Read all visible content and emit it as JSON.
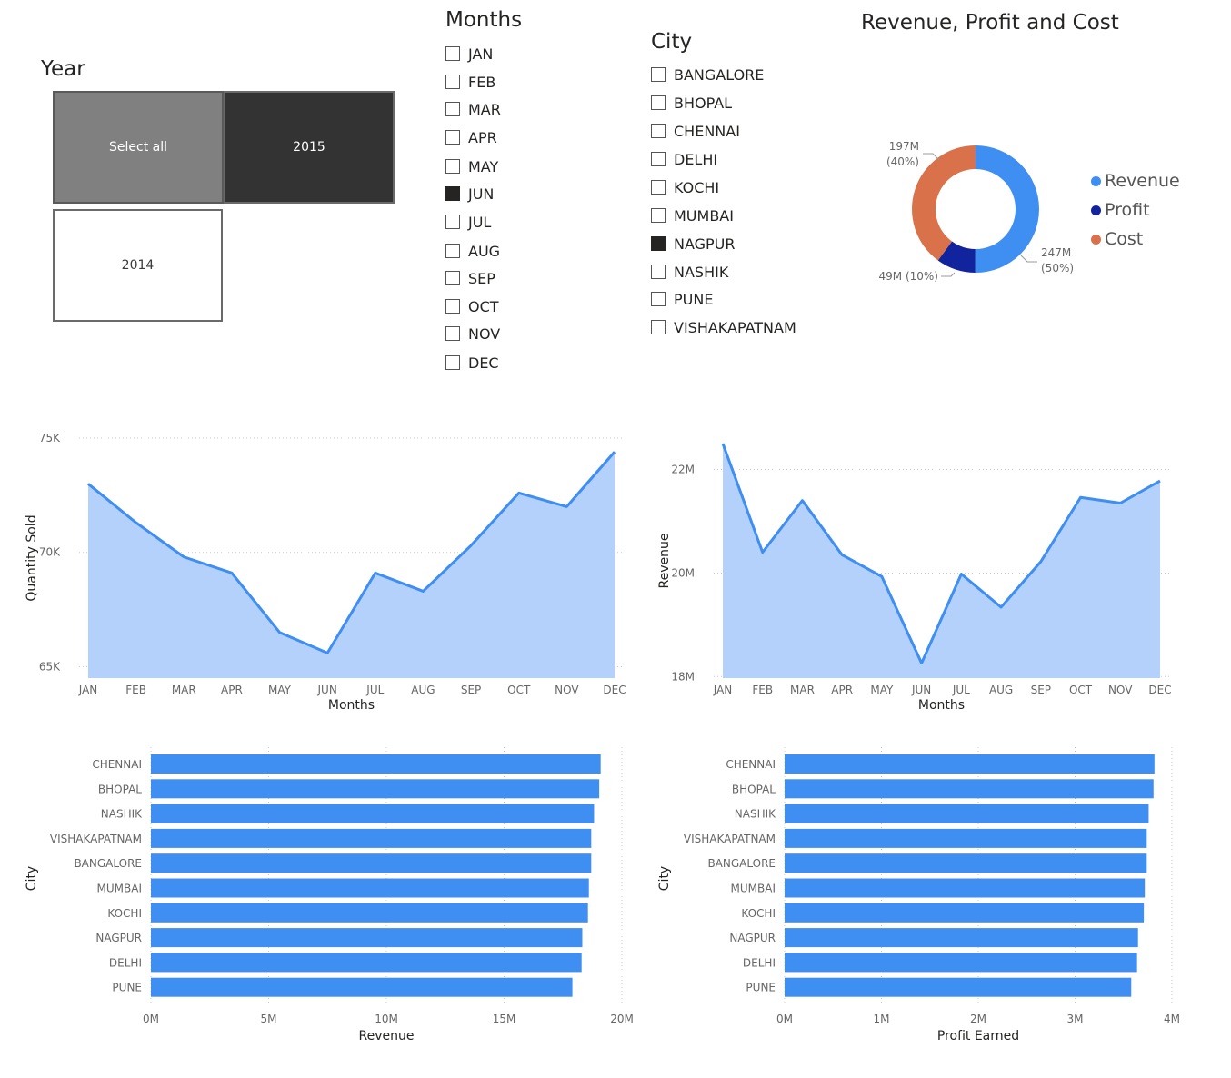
{
  "year_slicer": {
    "title": "Year",
    "tiles": [
      {
        "label": "Select all",
        "state": "partial"
      },
      {
        "label": "2015",
        "state": "selected"
      },
      {
        "label": "2014",
        "state": "unselected"
      }
    ]
  },
  "months_slicer": {
    "title": "Months",
    "items": [
      {
        "label": "JAN",
        "checked": false
      },
      {
        "label": "FEB",
        "checked": false
      },
      {
        "label": "MAR",
        "checked": false
      },
      {
        "label": "APR",
        "checked": false
      },
      {
        "label": "MAY",
        "checked": false
      },
      {
        "label": "JUN",
        "checked": true
      },
      {
        "label": "JUL",
        "checked": false
      },
      {
        "label": "AUG",
        "checked": false
      },
      {
        "label": "SEP",
        "checked": false
      },
      {
        "label": "OCT",
        "checked": false
      },
      {
        "label": "NOV",
        "checked": false
      },
      {
        "label": "DEC",
        "checked": false
      }
    ]
  },
  "city_slicer": {
    "title": "City",
    "items": [
      {
        "label": "BANGALORE",
        "checked": false
      },
      {
        "label": "BHOPAL",
        "checked": false
      },
      {
        "label": "CHENNAI",
        "checked": false
      },
      {
        "label": "DELHI",
        "checked": false
      },
      {
        "label": "KOCHI",
        "checked": false
      },
      {
        "label": "MUMBAI",
        "checked": false
      },
      {
        "label": "NAGPUR",
        "checked": true
      },
      {
        "label": "NASHIK",
        "checked": false
      },
      {
        "label": "PUNE",
        "checked": false
      },
      {
        "label": "VISHAKAPATNAM",
        "checked": false
      }
    ]
  },
  "colors": {
    "revenue": "#3f8ef2",
    "profit": "#12239e",
    "cost": "#d9714a",
    "area_fill": "#b4d1fb",
    "bar": "#3f8ef2"
  },
  "chart_data": [
    {
      "type": "pie",
      "title": "Revenue, Profit and Cost",
      "legend_position": "right",
      "slices": [
        {
          "name": "Revenue",
          "value": 247,
          "label_value": "247M",
          "label_pct": "(50%)"
        },
        {
          "name": "Profit",
          "value": 49,
          "label_value": "49M (10%)",
          "label_pct": ""
        },
        {
          "name": "Cost",
          "value": 197,
          "label_value": "197M",
          "label_pct": "(40%)"
        }
      ]
    },
    {
      "type": "area",
      "title": "",
      "xlabel": "Months",
      "ylabel": "Quantity Sold",
      "categories": [
        "JAN",
        "FEB",
        "MAR",
        "APR",
        "MAY",
        "JUN",
        "JUL",
        "AUG",
        "SEP",
        "OCT",
        "NOV",
        "DEC"
      ],
      "values": [
        73000,
        71300,
        69800,
        69100,
        66500,
        65600,
        69100,
        68300,
        70300,
        72600,
        72000,
        74400
      ],
      "ylim": [
        64500,
        75000
      ],
      "yticks": [
        65000,
        70000,
        75000
      ],
      "ytick_labels": [
        "65K",
        "70K",
        "75K"
      ]
    },
    {
      "type": "area",
      "title": "",
      "xlabel": "Months",
      "ylabel": "Revenue",
      "categories": [
        "JAN",
        "FEB",
        "MAR",
        "APR",
        "MAY",
        "JUN",
        "JUL",
        "AUG",
        "SEP",
        "OCT",
        "NOV",
        "DEC"
      ],
      "values": [
        22500000,
        20400000,
        21400000,
        20350000,
        19930000,
        18260000,
        19980000,
        19340000,
        20220000,
        21460000,
        21350000,
        21780000
      ],
      "ylim": [
        17970000,
        22500000
      ],
      "yticks": [
        18000000,
        20000000,
        22000000
      ],
      "ytick_labels": [
        "18M",
        "20M",
        "22M"
      ]
    },
    {
      "type": "bar",
      "orientation": "horizontal",
      "title": "",
      "xlabel": "Revenue",
      "ylabel": "City",
      "categories": [
        "CHENNAI",
        "BHOPAL",
        "NASHIK",
        "VISHAKAPATNAM",
        "BANGALORE",
        "MUMBAI",
        "KOCHI",
        "NAGPUR",
        "DELHI",
        "PUNE"
      ],
      "values": [
        19100000,
        19040000,
        18820000,
        18700000,
        18700000,
        18600000,
        18560000,
        18320000,
        18290000,
        17900000
      ],
      "xlim": [
        0,
        20000000
      ],
      "xticks": [
        0,
        5000000,
        10000000,
        15000000,
        20000000
      ],
      "xtick_labels": [
        "0M",
        "5M",
        "10M",
        "15M",
        "20M"
      ]
    },
    {
      "type": "bar",
      "orientation": "horizontal",
      "title": "",
      "xlabel": "Profit Earned",
      "ylabel": "City",
      "categories": [
        "CHENNAI",
        "BHOPAL",
        "NASHIK",
        "VISHAKAPATNAM",
        "BANGALORE",
        "MUMBAI",
        "KOCHI",
        "NAGPUR",
        "DELHI",
        "PUNE"
      ],
      "values": [
        3820000,
        3810000,
        3760000,
        3740000,
        3740000,
        3720000,
        3710000,
        3650000,
        3640000,
        3580000
      ],
      "xlim": [
        0,
        4000000
      ],
      "xticks": [
        0,
        1000000,
        2000000,
        3000000,
        4000000
      ],
      "xtick_labels": [
        "0M",
        "1M",
        "2M",
        "3M",
        "4M"
      ]
    }
  ]
}
